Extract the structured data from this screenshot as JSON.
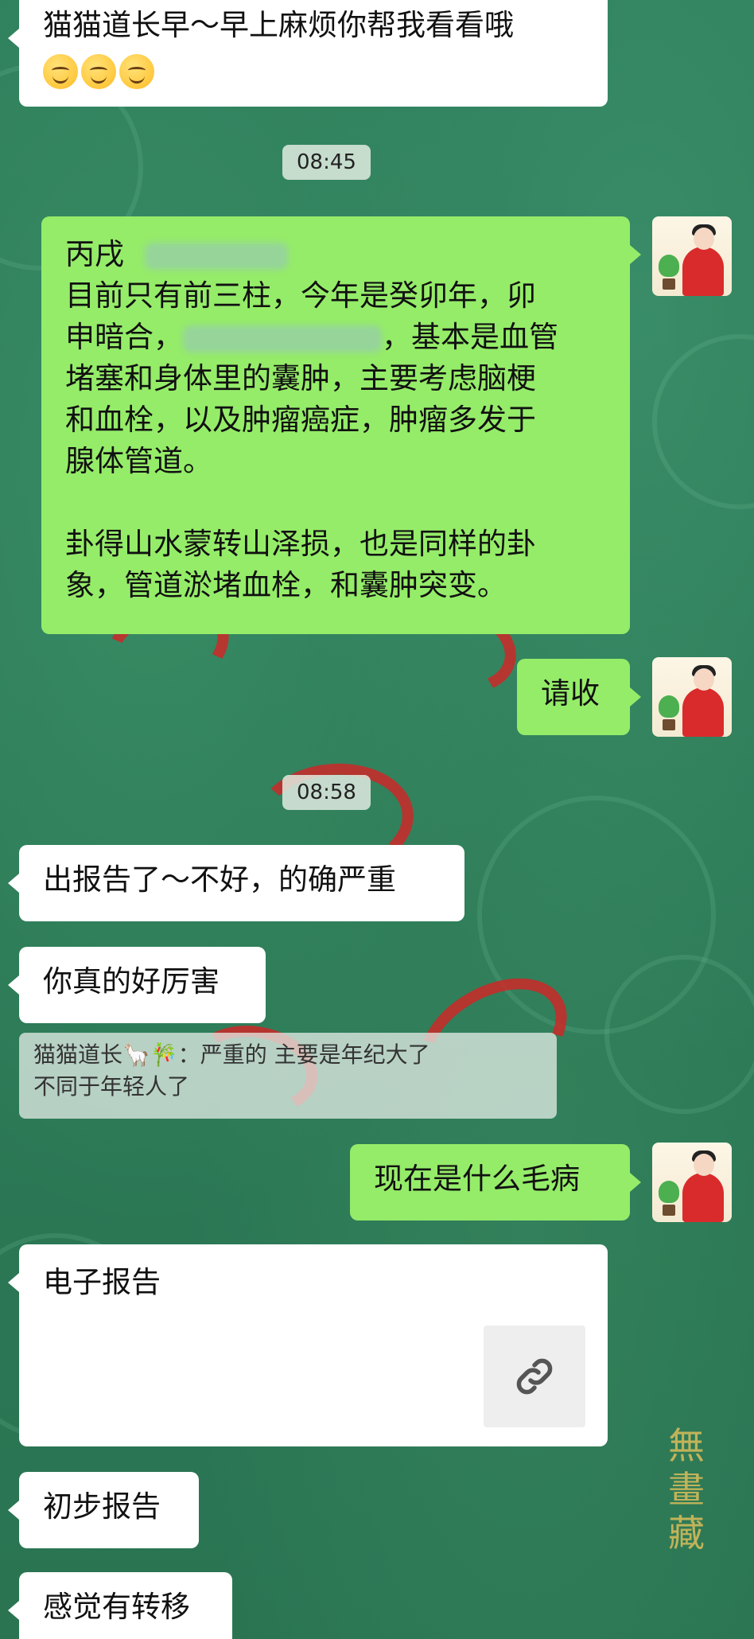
{
  "messages": {
    "m1": {
      "line1": "猫猫道长早～早上麻烦你帮我看看哦"
    },
    "time1": "08:45",
    "m2": {
      "line1_prefix": "丙戌",
      "line2": "目前只有前三柱，今年是癸卯年，卯",
      "line3_prefix": "申暗合，",
      "line3_suffix": "，基本是血管",
      "line4": "堵塞和身体里的囊肿，主要考虑脑梗",
      "line5": "和血栓，以及肿瘤癌症，肿瘤多发于",
      "line6": "腺体管道。",
      "line7": "卦得山水蒙转山泽损，也是同样的卦",
      "line8": "象，管道淤堵血栓，和囊肿突变。"
    },
    "m3": "请收",
    "time2": "08:58",
    "m4": "出报告了～不好，的确严重",
    "m5": "你真的好厉害",
    "quote": {
      "line1": "猫猫道长🦙🎋：严重的  主要是年纪大了",
      "line2": "不同于年轻人了"
    },
    "m6": "现在是什么毛病",
    "m7": "电子报告",
    "m8": "初步报告",
    "m9": "感觉有转移"
  },
  "icons": {
    "link": "link-icon",
    "emoji": "smiling-face-icon"
  },
  "colors": {
    "right_bubble": "#95ec69",
    "left_bubble": "#ffffff",
    "background": "#2f7d5c"
  }
}
